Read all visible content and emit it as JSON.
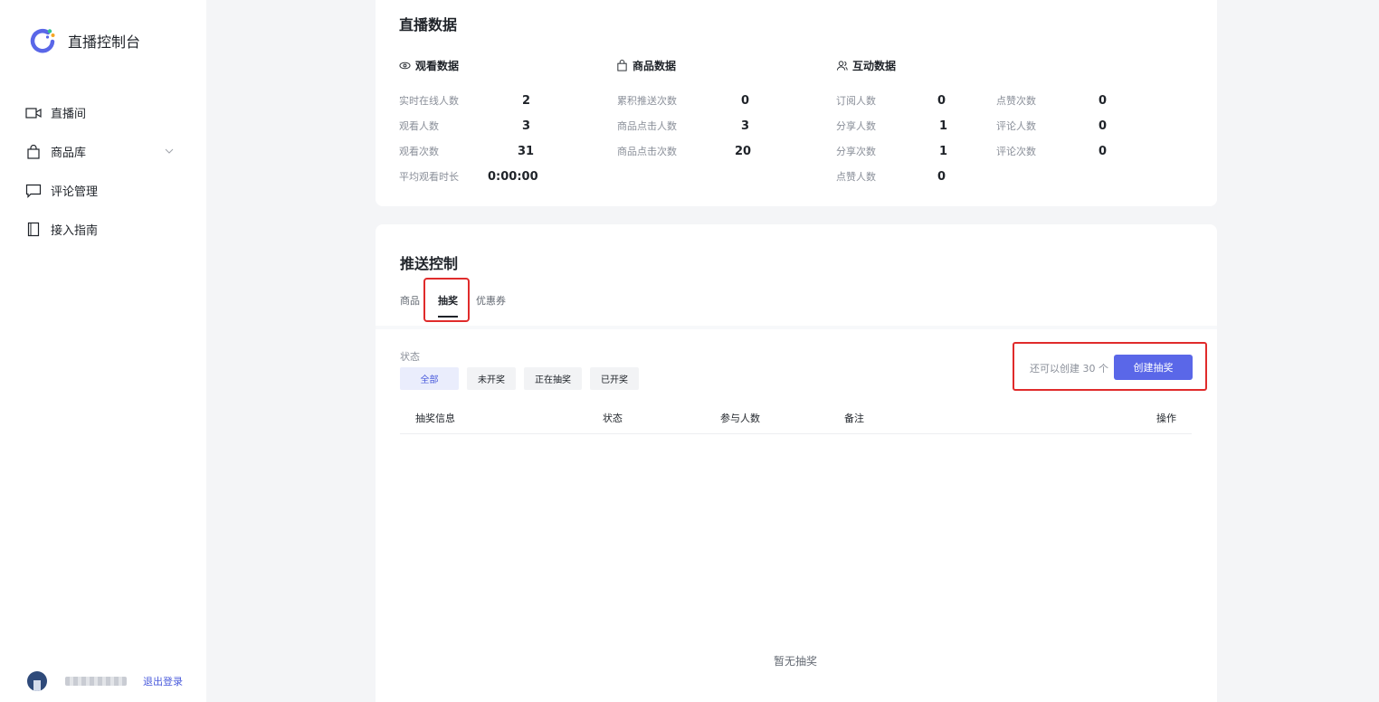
{
  "app": {
    "title": "直播控制台"
  },
  "sidebar": {
    "items": [
      {
        "label": "直播间",
        "icon": "video-camera-icon"
      },
      {
        "label": "商品库",
        "icon": "shopping-bag-icon",
        "expandable": true
      },
      {
        "label": "评论管理",
        "icon": "comment-icon"
      },
      {
        "label": "接入指南",
        "icon": "book-icon"
      }
    ],
    "user": {
      "logout_label": "退出登录"
    }
  },
  "stats": {
    "title": "直播数据",
    "viewing": {
      "title": "观看数据",
      "metrics": [
        {
          "label": "实时在线人数",
          "value": "2"
        },
        {
          "label": "观看人数",
          "value": "3"
        },
        {
          "label": "观看次数",
          "value": "31"
        },
        {
          "label": "平均观看时长",
          "value": "0:00:00"
        }
      ]
    },
    "goods": {
      "title": "商品数据",
      "metrics": [
        {
          "label": "累积推送次数",
          "value": "0"
        },
        {
          "label": "商品点击人数",
          "value": "3"
        },
        {
          "label": "商品点击次数",
          "value": "20"
        }
      ]
    },
    "interaction": {
      "title": "互动数据",
      "metrics": [
        {
          "label": "订阅人数",
          "value": "0"
        },
        {
          "label": "分享人数",
          "value": "1"
        },
        {
          "label": "分享次数",
          "value": "1"
        },
        {
          "label": "点赞人数",
          "value": "0"
        },
        {
          "label": "点赞次数",
          "value": "0"
        },
        {
          "label": "评论人数",
          "value": "0"
        },
        {
          "label": "评论次数",
          "value": "0"
        }
      ]
    }
  },
  "push": {
    "title": "推送控制",
    "tabs": [
      {
        "label": "商品",
        "active": false
      },
      {
        "label": "抽奖",
        "active": true
      },
      {
        "label": "优惠券",
        "active": false
      }
    ],
    "status_label": "状态",
    "filters": [
      {
        "label": "全部",
        "active": true
      },
      {
        "label": "未开奖",
        "active": false
      },
      {
        "label": "正在抽奖",
        "active": false
      },
      {
        "label": "已开奖",
        "active": false
      }
    ],
    "remaining_text": "还可以创建 30 个",
    "create_button": "创建抽奖",
    "table_headers": [
      "抽奖信息",
      "状态",
      "参与人数",
      "备注",
      "操作"
    ],
    "empty_text": "暂无抽奖"
  },
  "colors": {
    "accent": "#5a67e8",
    "highlight": "#e02b2b"
  }
}
